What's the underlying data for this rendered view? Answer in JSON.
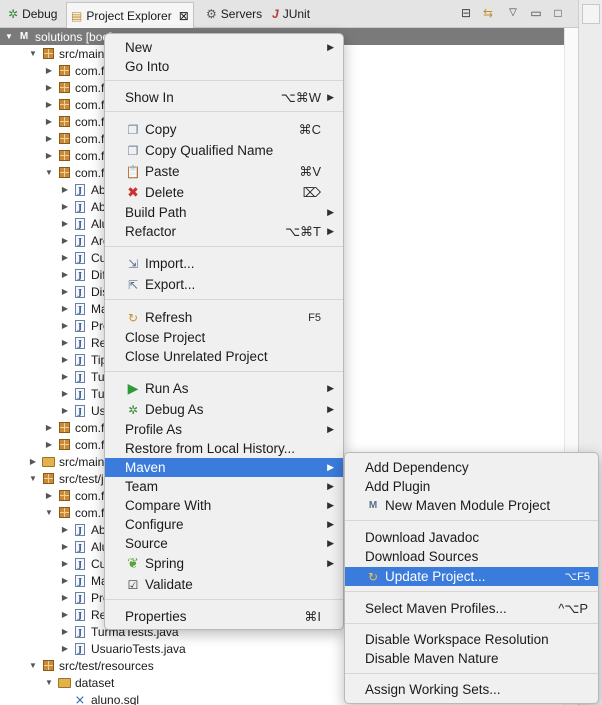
{
  "tabs": [
    {
      "label": "Debug",
      "icon": "bug-icon"
    },
    {
      "label": "Project Explorer",
      "icon": "project-explorer-icon",
      "active": true
    },
    {
      "label": "Servers",
      "icon": "servers-icon"
    },
    {
      "label": "JUnit",
      "icon": "junit-icon"
    }
  ],
  "tree": {
    "project_label": "solutions [boo]",
    "rows": [
      {
        "label": "src/main/"
      },
      {
        "label": "com.fl"
      },
      {
        "label": "com.fl"
      },
      {
        "label": "com.fl"
      },
      {
        "label": "com.fl"
      },
      {
        "label": "com.fl"
      },
      {
        "label": "com.fl"
      },
      {
        "label": "com.fl"
      },
      {
        "label": "Ab"
      },
      {
        "label": "Ab"
      },
      {
        "label": "Alu"
      },
      {
        "label": "Are"
      },
      {
        "label": "Cu"
      },
      {
        "label": "Dif"
      },
      {
        "label": "Dis"
      },
      {
        "label": "Ma"
      },
      {
        "label": "Pro"
      },
      {
        "label": "Ret"
      },
      {
        "label": "Tip"
      },
      {
        "label": "Tur"
      },
      {
        "label": "Tur"
      },
      {
        "label": "Usu"
      },
      {
        "label": "com.fl"
      },
      {
        "label": "com.fl"
      },
      {
        "label": "src/main/"
      },
      {
        "label": "src/test/j"
      },
      {
        "label": "com.fl"
      },
      {
        "label": "com.fl"
      },
      {
        "label": "Ab"
      },
      {
        "label": "Alu"
      },
      {
        "label": "Cu"
      },
      {
        "label": "Ma"
      },
      {
        "label": "Pro"
      },
      {
        "label": "Ret"
      },
      {
        "label": "TurmaTests.java"
      },
      {
        "label": "UsuarioTests.java"
      },
      {
        "label": "src/test/resources"
      },
      {
        "label": "dataset"
      },
      {
        "label": "aluno.sql"
      }
    ]
  },
  "context_menu": {
    "new": "New",
    "go_into": "Go Into",
    "show_in": "Show In",
    "show_in_shortcut": "⌥⌘W",
    "copy": "Copy",
    "copy_shortcut": "⌘C",
    "copy_qualified_name": "Copy Qualified Name",
    "paste": "Paste",
    "paste_shortcut": "⌘V",
    "delete": "Delete",
    "delete_shortcut": "⌦",
    "build_path": "Build Path",
    "refactor": "Refactor",
    "refactor_shortcut": "⌥⌘T",
    "import": "Import...",
    "export": "Export...",
    "refresh": "Refresh",
    "refresh_shortcut": "F5",
    "close_project": "Close Project",
    "close_unrelated_project": "Close Unrelated Project",
    "run_as": "Run As",
    "debug_as": "Debug As",
    "profile_as": "Profile As",
    "restore_local_history": "Restore from Local History...",
    "maven": "Maven",
    "team": "Team",
    "compare_with": "Compare With",
    "configure": "Configure",
    "source": "Source",
    "spring": "Spring",
    "validate": "Validate",
    "properties": "Properties",
    "properties_shortcut": "⌘I"
  },
  "maven_menu": {
    "add_dependency": "Add Dependency",
    "add_plugin": "Add Plugin",
    "new_maven_module_project": "New Maven Module Project",
    "download_javadoc": "Download Javadoc",
    "download_sources": "Download Sources",
    "update_project": "Update Project...",
    "update_project_shortcut": "⌥F5",
    "select_maven_profiles": "Select Maven Profiles...",
    "select_maven_profiles_shortcut": "^⌥P",
    "disable_workspace_resolution": "Disable Workspace Resolution",
    "disable_maven_nature": "Disable Maven Nature",
    "assign_working_sets": "Assign Working Sets..."
  }
}
